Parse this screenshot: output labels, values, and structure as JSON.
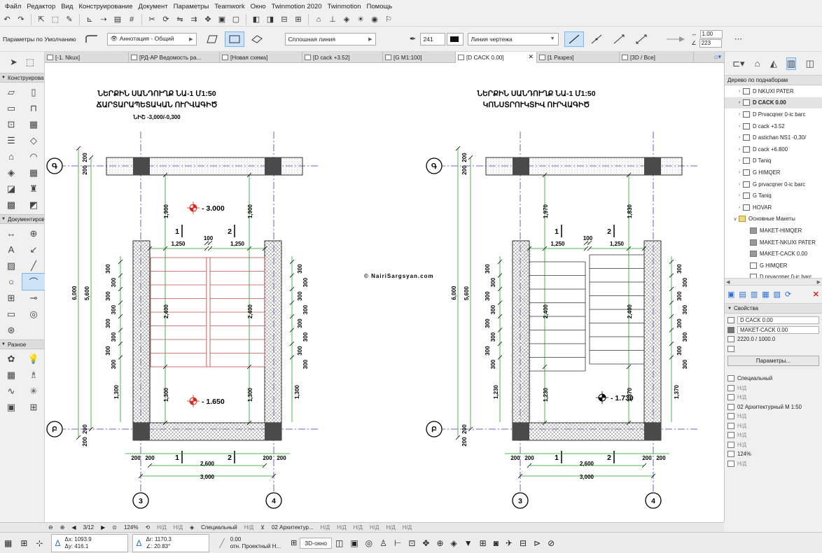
{
  "menu": [
    "Файл",
    "Редактор",
    "Вид",
    "Конструирование",
    "Документ",
    "Параметры",
    "Teamwork",
    "Окно",
    "Twinmotion 2020",
    "Twinmotion",
    "Помощь"
  ],
  "toolbar2": {
    "defaults_label": "Параметры по Умолчанию",
    "annotation_combo": "Аннотация - Общий",
    "line_type_combo": "Сплошная линия",
    "pen_number": "241",
    "line_category_combo": "Линия чертежа",
    "scale_a": "1.00",
    "scale_b": "223"
  },
  "toolbox": {
    "sections": [
      "Конструирование",
      "Документирование",
      "Разное"
    ]
  },
  "tabs": [
    {
      "label": "[-1. Nkux]"
    },
    {
      "label": "[РД-АР Ведомость ра..."
    },
    {
      "label": "[Новая схема]"
    },
    {
      "label": "[D cack +3.52]"
    },
    {
      "label": "[G M1:100]"
    },
    {
      "label": "[D CACK 0.00]",
      "close": "✕"
    },
    {
      "label": "[1 Разрез]"
    },
    {
      "label": "[3D / Все]"
    }
  ],
  "drawing": {
    "left": {
      "title1": "ՆԵՐՔԻՆ ՍԱՆԴՈՒՂՔ  ՆԱ-1  Մ1:50",
      "title2": "ՃԱՐՏԱՐԱՊԵՏԱԿԱՆ ՈՒՐՎԱԳԻԾ",
      "title3": "ՆԻՇ -3,000/-0,300",
      "level_top": "- 3.000",
      "level_bottom": "- 1.650",
      "dim_total_h": "6,000",
      "dim_inner_h": "5,600",
      "dim_top": "1,900",
      "dim_top_r": "1,900",
      "dim_flight": "2,400",
      "dim_bottom": "1,300",
      "dim_w1": "1,250",
      "dim_gap": "100",
      "dim_w2": "1,250",
      "dim_inner_w": "2,600",
      "dim_total_w": "3,000",
      "dim_200": "200",
      "dim_300": "300"
    },
    "right": {
      "title1": "ՆԵՐՔԻՆ ՍԱՆԴՈՒՂՔ  ՆԱ-1  Մ1:50",
      "title2": "ԿՈՆՍՏՐՈՒԿՏԻՎ ՈՒՐՎԱԳԻԾ",
      "level_mid": "- 1.730",
      "dim_total_h": "6,000",
      "dim_inner_h": "5,600",
      "dim_top": "1,970",
      "dim_top_r": "1,830",
      "dim_flight": "2,400",
      "dim_bottom": "1,230",
      "dim_bottom_r": "1,370",
      "dim_w1": "1,250",
      "dim_gap": "100",
      "dim_w2": "1,250",
      "dim_inner_w": "2,600",
      "dim_total_w": "3,000",
      "dim_200": "200",
      "dim_300": "300"
    },
    "axis_top": "Գ",
    "axis_bottom": "Բ",
    "axis_3": "3",
    "axis_4": "4",
    "cut_1": "1",
    "cut_2": "2",
    "watermark": "© NairiSargsyan.com"
  },
  "panel": {
    "title": "Дерево по поднаборам",
    "tree": [
      {
        "label": "D NKUXI PATER",
        "icon": "view",
        "exp": "›"
      },
      {
        "label": "D CACK 0.00",
        "icon": "view",
        "exp": "›",
        "selected": true
      },
      {
        "label": "D Prvacqner 0-ic barc",
        "icon": "view",
        "exp": "›"
      },
      {
        "label": "D cack +3.52",
        "icon": "view",
        "exp": "›"
      },
      {
        "label": "D astichan NS1 -0,30/",
        "icon": "view",
        "exp": "›"
      },
      {
        "label": "D cack +6.800",
        "icon": "view",
        "exp": "›"
      },
      {
        "label": "D Taniq",
        "icon": "view",
        "exp": "›"
      },
      {
        "label": "G HIMQER",
        "icon": "view",
        "exp": "›"
      },
      {
        "label": "G prvacqner 0-ic barc",
        "icon": "view",
        "exp": "›"
      },
      {
        "label": "G Taniq",
        "icon": "view",
        "exp": "›"
      },
      {
        "label": "HOVAR",
        "icon": "view",
        "exp": "›"
      },
      {
        "label": "Основные Макеты",
        "icon": "folder",
        "exp": "∨"
      },
      {
        "label": "MAKET-HIMQER",
        "icon": "book",
        "exp": ""
      },
      {
        "label": "MAKET-NKUXI PATER",
        "icon": "book",
        "exp": ""
      },
      {
        "label": "MAKET-CACK 0.00",
        "icon": "book",
        "exp": ""
      },
      {
        "label": "G HIMQER",
        "icon": "view",
        "exp": ""
      },
      {
        "label": "D prvacqner 0-ic barc",
        "icon": "view",
        "exp": ""
      }
    ],
    "props_title": "Свойства",
    "prop_view": "D CACK 0.00",
    "prop_layout": "MAKET-CACK 0.00",
    "prop_size": "2220.0 / 1000.0",
    "params_button": "Параметры...",
    "prop_list": [
      {
        "label": "Специальный",
        "na": false
      },
      {
        "label": "Н/Д",
        "na": true
      },
      {
        "label": "Н/Д",
        "na": true
      },
      {
        "label": "02 Архитектурный М 1:50",
        "na": false
      },
      {
        "label": "Н/Д",
        "na": true
      },
      {
        "label": "Н/Д",
        "na": true
      },
      {
        "label": "Н/Д",
        "na": true
      },
      {
        "label": "Н/Д",
        "na": true
      },
      {
        "label": "124%",
        "na": false
      },
      {
        "label": "Н/Д",
        "na": true
      }
    ]
  },
  "statusnav": {
    "page": "3/12",
    "zoom": "124%",
    "na1": "Н/Д",
    "na2": "Н/Д",
    "special": "Специальный",
    "na3": "Н/Д",
    "arch": "02 Архитектур...",
    "na4": "Н/Д",
    "na5": "Н/Д",
    "na6": "Н/Д",
    "na7": "Н/Д",
    "na8": "Н/Д",
    "na9": "Н/Д"
  },
  "infobar": {
    "dx": "Δx: 1093.9",
    "dy": "Δy: 416.1",
    "dr": "Δr: 1170.3",
    "da": "∠: 20.83°",
    "z": "0.00",
    "ref": "отн. Проектный Н...",
    "view3d": "3D-окно"
  },
  "colors": {
    "accent": "#2a6fd6",
    "red_level": "#d8281e",
    "axis_line": "#3a3ab8",
    "dim_green": "#1ea01e",
    "stair_red": "#c0504d"
  }
}
